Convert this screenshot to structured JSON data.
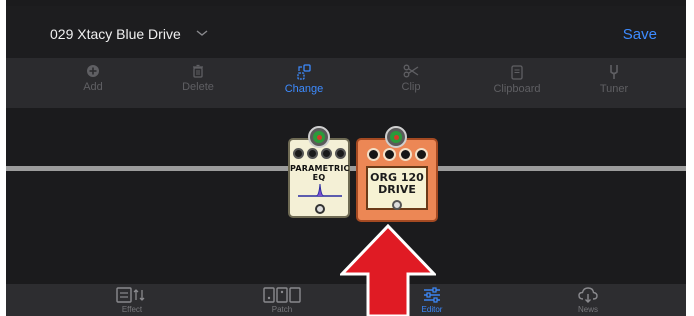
{
  "header": {
    "patch_name": "029 Xtacy Blue Drive",
    "save_label": "Save"
  },
  "toolbar": {
    "items": [
      {
        "label": "Add",
        "icon": "plus-circle-icon",
        "active": false
      },
      {
        "label": "Delete",
        "icon": "trash-icon",
        "active": false
      },
      {
        "label": "Change",
        "icon": "change-icon",
        "active": true
      },
      {
        "label": "Clip",
        "icon": "scissors-icon",
        "active": false
      },
      {
        "label": "Clipboard",
        "icon": "clipboard-icon",
        "active": false
      },
      {
        "label": "Tuner",
        "icon": "tuning-fork-icon",
        "active": false
      }
    ]
  },
  "pedals": [
    {
      "name": "PARAMETRIC",
      "name2": "EQ"
    },
    {
      "name": "ORG 120",
      "name2": "DRIVE"
    }
  ],
  "tabs": [
    {
      "label": "Effect",
      "icon": "effect-icon",
      "active": false
    },
    {
      "label": "Patch",
      "icon": "patch-icon",
      "active": false
    },
    {
      "label": "Editor",
      "icon": "sliders-icon",
      "active": true
    },
    {
      "label": "News",
      "icon": "cloud-icon",
      "active": false
    }
  ],
  "colors": {
    "accent": "#3d8bff",
    "arrow": "#e01b24"
  }
}
